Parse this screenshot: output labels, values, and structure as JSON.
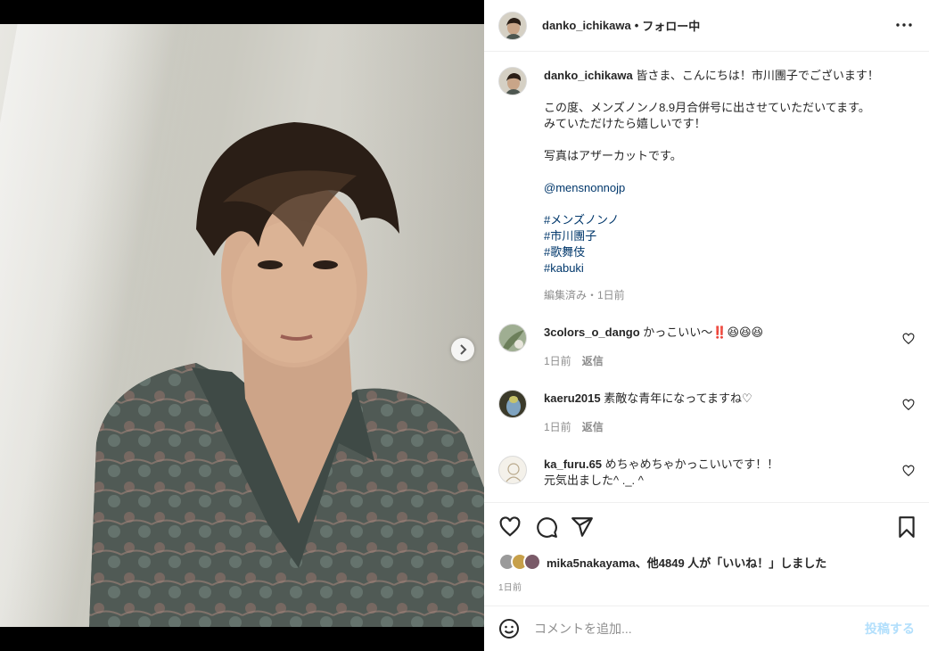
{
  "post": {
    "username": "danko_ichikawa",
    "separator": "•",
    "follow_status": "フォロー中",
    "caption_lines": [
      "皆さま、こんにちは！市川團子でございます！",
      "",
      "この度、メンズノンノ8.9月合併号に出させていただいてます。",
      "みていただけたら嬉しいです！",
      "",
      "写真はアザーカットです。"
    ],
    "mention": "@mensnonnojp",
    "hashtags": [
      "#メンズノンノ",
      "#市川團子",
      "#歌舞伎",
      "#kabuki"
    ],
    "caption_meta": "編集済み・1日前"
  },
  "comments": [
    {
      "username": "3colors_o_dango",
      "text": "かっこいい〜‼️😆😆😆",
      "time": "1日前",
      "reply": "返信"
    },
    {
      "username": "kaeru2015",
      "text": "素敵な青年になってますね♡",
      "time": "1日前",
      "reply": "返信"
    },
    {
      "username": "ka_furu.65",
      "text_line1": "めちゃめちゃかっこいいです！！",
      "text_line2": "元気出ました^ ._. ^"
    }
  ],
  "likes": {
    "user": "mika5nakayama",
    "rest": "、他4849 人が「いいね！」しました"
  },
  "date": "1日前",
  "comment_box": {
    "placeholder": "コメントを追加...",
    "post_label": "投稿する"
  },
  "carousel": {
    "slide_count": 1,
    "current": 1
  }
}
